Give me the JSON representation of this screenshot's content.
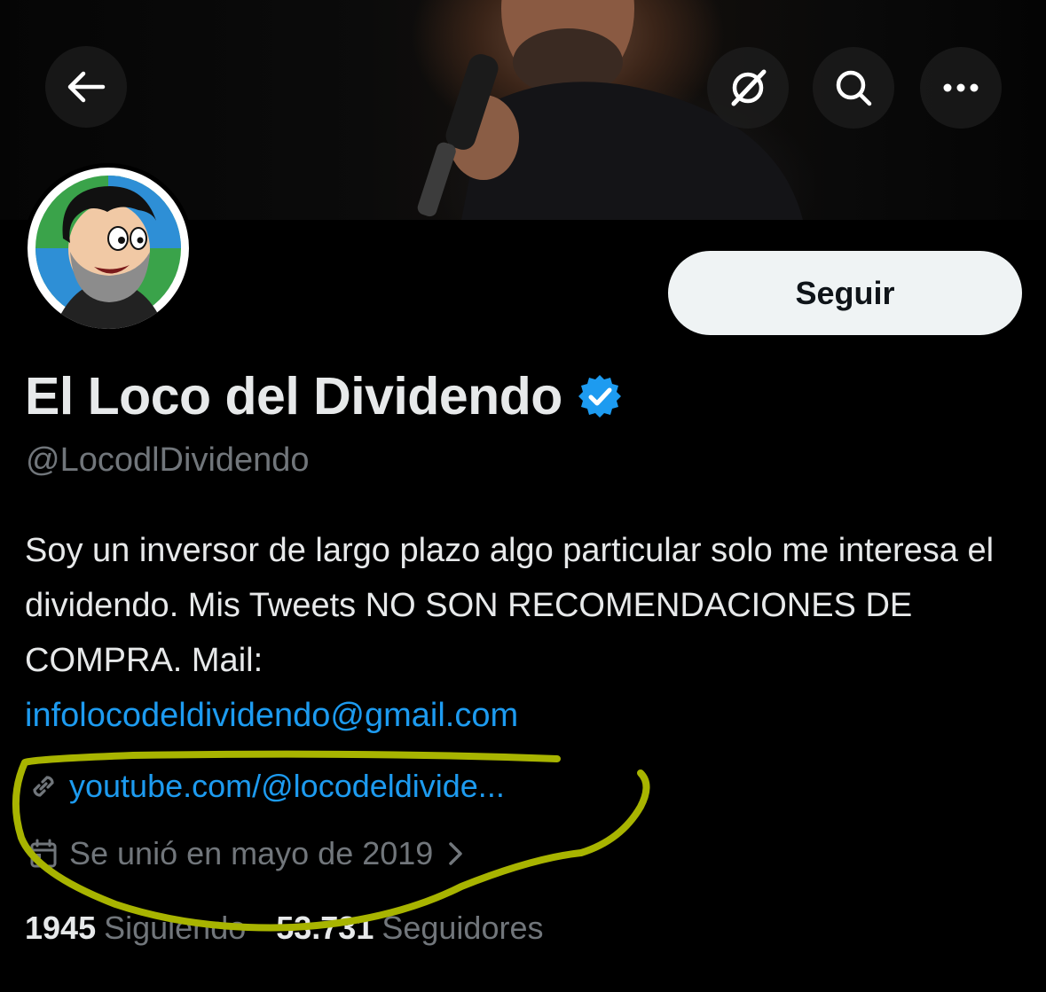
{
  "header": {
    "back_icon": "arrow-left-icon",
    "grok_icon": "grok-icon",
    "search_icon": "search-icon",
    "more_icon": "more-horizontal-icon"
  },
  "profile": {
    "follow_label": "Seguir",
    "display_name": "El Loco del Dividendo",
    "handle": "@LocodlDividendo",
    "bio": "Soy un inversor de largo plazo algo particular solo me interesa el dividendo. Mis Tweets NO SON RECOMENDACIONES DE COMPRA. Mail:",
    "bio_email": "infolocodeldividendo@gmail.com",
    "website": "youtube.com/@locodeldivide...",
    "joined": "Se unió en mayo de 2019",
    "following_count": "1945",
    "following_label": "Siguiendo",
    "followers_count": "53.731",
    "followers_label": "Seguidores"
  },
  "colors": {
    "background": "#000000",
    "accent": "#1d9bf0",
    "secondary_text": "#71767b",
    "highlight_annotation": "#a8b400"
  }
}
